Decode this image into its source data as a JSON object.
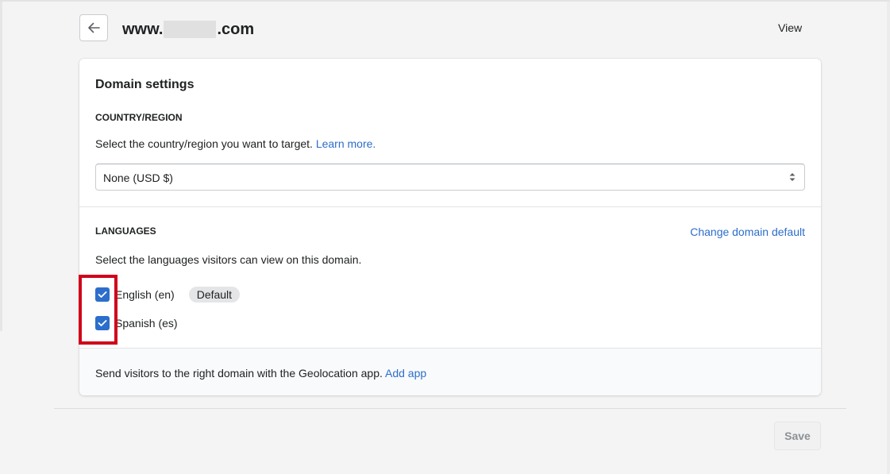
{
  "header": {
    "title_prefix": "www.",
    "title_suffix": ".com",
    "view_label": "View",
    "back_icon": "arrow-left-icon"
  },
  "card": {
    "title": "Domain settings",
    "country": {
      "heading": "COUNTRY/REGION",
      "description": "Select the country/region you want to target.",
      "learn_more": "Learn more.",
      "selected": "None (USD $)",
      "select_icon": "select-arrows-icon"
    },
    "languages": {
      "heading": "LANGUAGES",
      "change_default": "Change domain default",
      "description": "Select the languages visitors can view on this domain.",
      "items": [
        {
          "label": "English (en)",
          "checked": true,
          "badge": "Default"
        },
        {
          "label": "Spanish (es)",
          "checked": true
        }
      ],
      "check_icon": "checkmark-icon"
    },
    "footer": {
      "text": "Send visitors to the right domain with the Geolocation app.",
      "link": "Add app"
    }
  },
  "actions": {
    "save_label": "Save"
  },
  "colors": {
    "accent": "#2c6ecb",
    "highlight": "#d0021b",
    "background": "#f4f4f4"
  }
}
